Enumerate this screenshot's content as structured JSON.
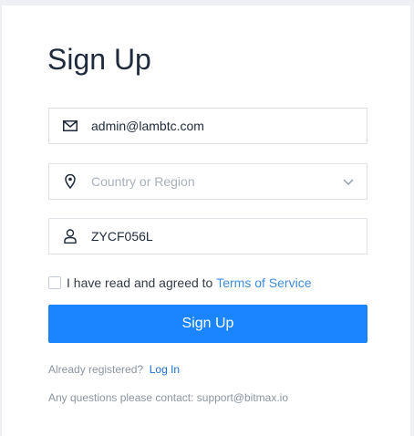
{
  "form": {
    "title": "Sign Up",
    "email": {
      "value": "admin@lambtc.com",
      "icon": "envelope-icon"
    },
    "country": {
      "placeholder": "Country or Region",
      "icon": "location-pin-icon",
      "dropdown_icon": "chevron-down-icon"
    },
    "username": {
      "value": "ZYCF056L",
      "icon": "user-icon"
    },
    "agree": {
      "text": "I have read and agreed to ",
      "link": "Terms of Service",
      "checked": false
    },
    "submit_label": "Sign Up",
    "already": {
      "text": "Already registered? ",
      "link": "Log In"
    },
    "contact": "Any questions please contact: support@bitmax.io"
  },
  "colors": {
    "primary": "#1a85ff",
    "link": "#3e8de0",
    "title": "#1f2a3c",
    "muted": "#8c95a2",
    "border": "#dfe3e8"
  }
}
